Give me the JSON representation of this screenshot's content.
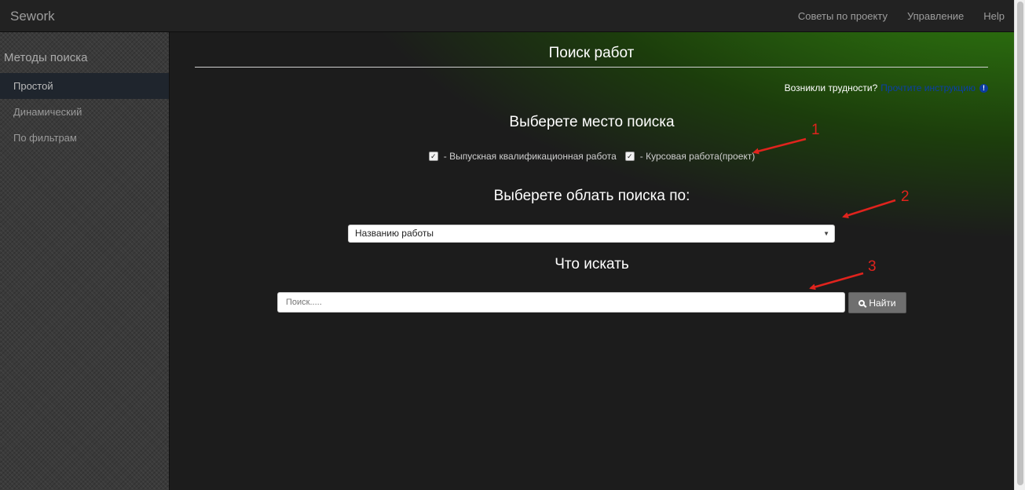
{
  "navbar": {
    "brand": "Sework",
    "links": [
      "Советы по проекту",
      "Управление",
      "Help"
    ]
  },
  "sidebar": {
    "title": "Методы поиска",
    "items": [
      {
        "label": "Простой",
        "active": true
      },
      {
        "label": "Динамический",
        "active": false
      },
      {
        "label": "По фильтрам",
        "active": false
      }
    ]
  },
  "main": {
    "title": "Поиск работ",
    "help_text": "Возникли трудности?",
    "help_link": "Прочтите инструкцию",
    "place_heading": "Выберете место поиска",
    "checkboxes": [
      {
        "label": "- Выпускная квалификационная работа",
        "checked": true
      },
      {
        "label": "- Курсовая работа(проект)",
        "checked": true
      }
    ],
    "area_heading": "Выберете облать поиска по:",
    "area_select_value": "Названию работы",
    "what_heading": "Что искать",
    "search_placeholder": "Поиск.....",
    "search_button": "Найти"
  },
  "annotations": [
    "1",
    "2",
    "3"
  ],
  "colors": {
    "accent_green": "#3a8a12",
    "annotation_red": "#e0231d",
    "link_blue": "#0a3ea8"
  }
}
